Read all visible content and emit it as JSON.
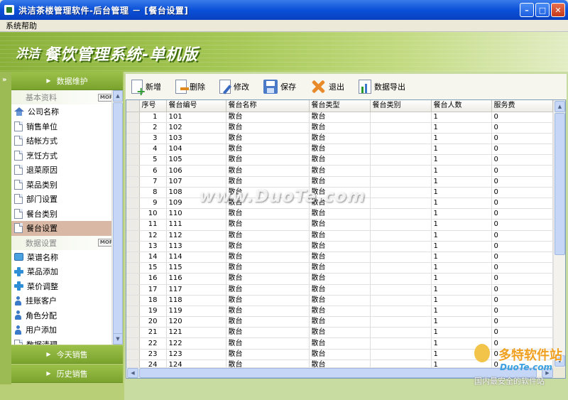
{
  "window": {
    "title": "洪洁茶楼管理软件-后台管理 － [餐台设置]",
    "minimize": "–",
    "maximize": "□",
    "close": "✕"
  },
  "menu": {
    "help": "系统帮助"
  },
  "banner": {
    "brand": "洪洁",
    "system": "餐饮管理系统-单机版"
  },
  "sidebar": {
    "panel_data_maintenance": "数据维护",
    "section_basic": "基本资料",
    "section_data": "数据设置",
    "more_label": "MORE",
    "basic_items": [
      {
        "label": "公司名称",
        "icon": "home-icon"
      },
      {
        "label": "销售单位",
        "icon": "document-icon"
      },
      {
        "label": "结帐方式",
        "icon": "document-icon"
      },
      {
        "label": "烹饪方式",
        "icon": "document-icon"
      },
      {
        "label": "退菜原因",
        "icon": "document-icon"
      },
      {
        "label": "菜品类别",
        "icon": "document-icon"
      },
      {
        "label": "部门设置",
        "icon": "document-icon"
      },
      {
        "label": "餐台类别",
        "icon": "document-icon"
      },
      {
        "label": "餐台设置",
        "icon": "document-icon"
      }
    ],
    "data_items": [
      {
        "label": "菜谱名称",
        "icon": "book-icon"
      },
      {
        "label": "菜品添加",
        "icon": "plus-icon"
      },
      {
        "label": "菜价调整",
        "icon": "plus-icon"
      },
      {
        "label": "挂账客户",
        "icon": "person-icon"
      },
      {
        "label": "角色分配",
        "icon": "person-icon"
      },
      {
        "label": "用户添加",
        "icon": "person-icon"
      },
      {
        "label": "数据清理",
        "icon": "document-icon"
      }
    ],
    "panel_today_sales": "今天销售",
    "panel_history_sales": "历史销售"
  },
  "toolbar": {
    "new": "新增",
    "delete": "删除",
    "edit": "修改",
    "save": "保存",
    "exit": "退出",
    "export": "数据导出"
  },
  "table": {
    "columns": [
      "序号",
      "餐台编号",
      "餐台名称",
      "餐台类型",
      "餐台类别",
      "餐台人数",
      "服务费"
    ],
    "rows": [
      [
        "1",
        "101",
        "散台",
        "散台",
        "",
        "1",
        "0"
      ],
      [
        "2",
        "102",
        "散台",
        "散台",
        "",
        "1",
        "0"
      ],
      [
        "3",
        "103",
        "散台",
        "散台",
        "",
        "1",
        "0"
      ],
      [
        "4",
        "104",
        "散台",
        "散台",
        "",
        "1",
        "0"
      ],
      [
        "5",
        "105",
        "散台",
        "散台",
        "",
        "1",
        "0"
      ],
      [
        "6",
        "106",
        "散台",
        "散台",
        "",
        "1",
        "0"
      ],
      [
        "7",
        "107",
        "散台",
        "散台",
        "",
        "1",
        "0"
      ],
      [
        "8",
        "108",
        "散台",
        "散台",
        "",
        "1",
        "0"
      ],
      [
        "9",
        "109",
        "散台",
        "散台",
        "",
        "1",
        "0"
      ],
      [
        "10",
        "110",
        "散台",
        "散台",
        "",
        "1",
        "0"
      ],
      [
        "11",
        "111",
        "散台",
        "散台",
        "",
        "1",
        "0"
      ],
      [
        "12",
        "112",
        "散台",
        "散台",
        "",
        "1",
        "0"
      ],
      [
        "13",
        "113",
        "散台",
        "散台",
        "",
        "1",
        "0"
      ],
      [
        "14",
        "114",
        "散台",
        "散台",
        "",
        "1",
        "0"
      ],
      [
        "15",
        "115",
        "散台",
        "散台",
        "",
        "1",
        "0"
      ],
      [
        "16",
        "116",
        "散台",
        "散台",
        "",
        "1",
        "0"
      ],
      [
        "17",
        "117",
        "散台",
        "散台",
        "",
        "1",
        "0"
      ],
      [
        "18",
        "118",
        "散台",
        "散台",
        "",
        "1",
        "0"
      ],
      [
        "19",
        "119",
        "散台",
        "散台",
        "",
        "1",
        "0"
      ],
      [
        "20",
        "120",
        "散台",
        "散台",
        "",
        "1",
        "0"
      ],
      [
        "21",
        "121",
        "散台",
        "散台",
        "",
        "1",
        "0"
      ],
      [
        "22",
        "122",
        "散台",
        "散台",
        "",
        "1",
        "0"
      ],
      [
        "23",
        "123",
        "散台",
        "散台",
        "",
        "1",
        "0"
      ],
      [
        "24",
        "124",
        "散台",
        "散台",
        "",
        "1",
        "0"
      ]
    ]
  },
  "watermarks": {
    "center": "www.DuoTe.com",
    "corner_brand": "多特软件站",
    "corner_url": "DuoTe.com",
    "corner_slogan": "国内最安全的软件站"
  },
  "colors": {
    "titlebar": "#0a50d8",
    "banner": "#a5c755",
    "sidebar_header": "#8bb23c",
    "active_item": "#d9b9a5"
  }
}
